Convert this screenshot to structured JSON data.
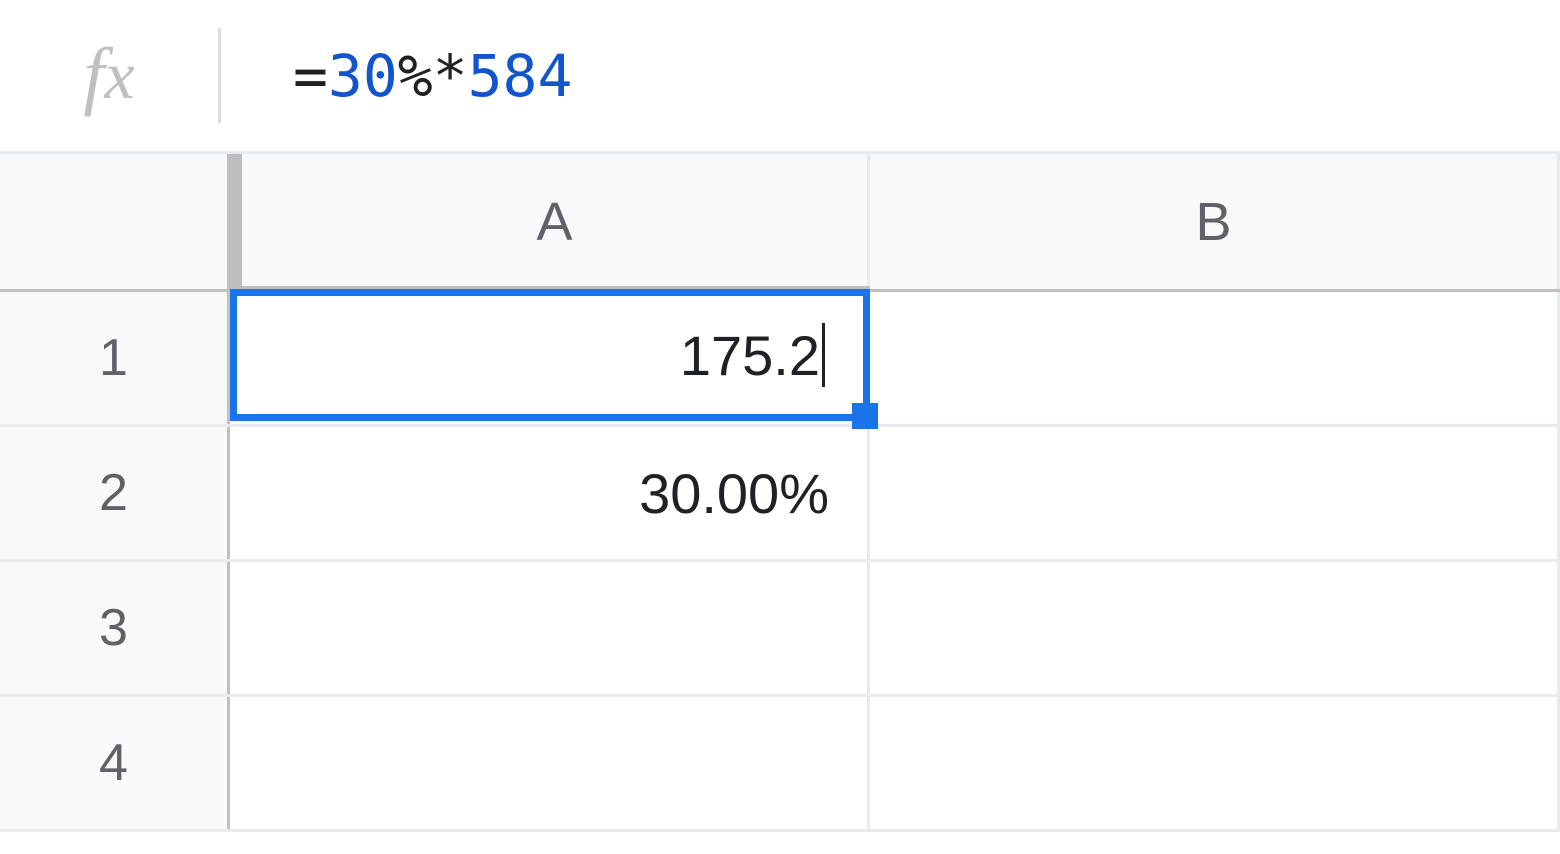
{
  "formula_bar": {
    "fx_label": "fx",
    "formula": {
      "equals": "=",
      "num1": "30",
      "op1": "%*",
      "num2": "584"
    }
  },
  "columns": {
    "a": "A",
    "b": "B"
  },
  "rows": {
    "r1": "1",
    "r2": "2",
    "r3": "3",
    "r4": "4"
  },
  "cells": {
    "a1": "175.2",
    "a2": "30.00%",
    "a3": "",
    "a4": "",
    "b1": "",
    "b2": "",
    "b3": "",
    "b4": ""
  },
  "selected_cell": "A1"
}
